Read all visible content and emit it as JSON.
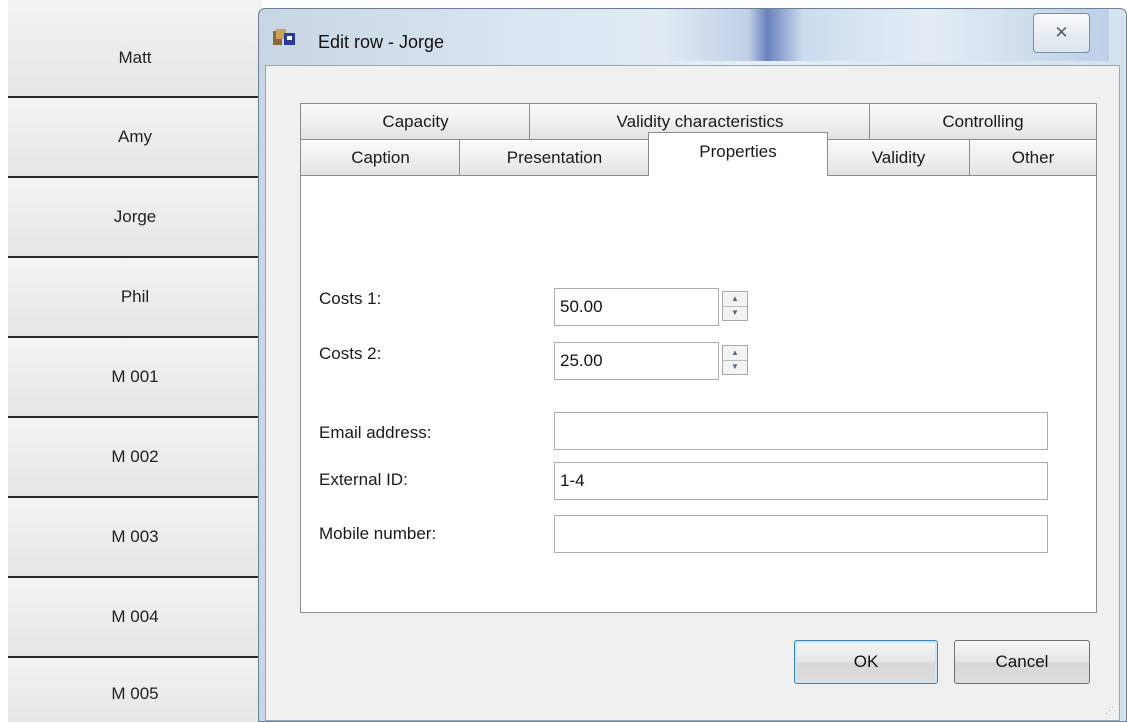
{
  "row_list": {
    "rows": [
      "Matt",
      "Amy",
      "Jorge",
      "Phil",
      "M 001",
      "M 002",
      "M 003",
      "M 004",
      "M 005"
    ]
  },
  "dialog": {
    "title": "Edit row - Jorge",
    "close_icon": "close-icon",
    "tabs_row1": [
      "Capacity",
      "Validity characteristics",
      "Controlling"
    ],
    "tabs_row2": [
      "Caption",
      "Presentation",
      "Properties",
      "Validity",
      "Other"
    ],
    "active_tab": "Properties",
    "fields": {
      "costs1": {
        "label": "Costs 1:",
        "value": "50.00"
      },
      "costs2": {
        "label": "Costs 2:",
        "value": "25.00"
      },
      "email": {
        "label": "Email address:",
        "value": ""
      },
      "external_id": {
        "label": "External ID:",
        "value": "1-4"
      },
      "mobile": {
        "label": "Mobile number:",
        "value": ""
      }
    },
    "buttons": {
      "ok": "OK",
      "cancel": "Cancel"
    }
  },
  "colors": {
    "title_bar": "#d9e5f0",
    "client_bg": "#f0f0f0",
    "ok_border": "#3c7fb1"
  }
}
